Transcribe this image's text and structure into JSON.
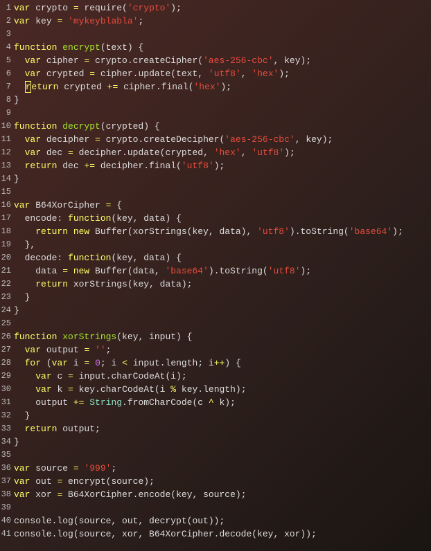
{
  "lines": [
    {
      "n": "1",
      "tokens": [
        [
          "kw",
          "var "
        ],
        [
          "ident",
          "crypto "
        ],
        [
          "op",
          "= "
        ],
        [
          "ident",
          "require"
        ],
        [
          "punct",
          "("
        ],
        [
          "str",
          "'crypto'"
        ],
        [
          "punct",
          ");"
        ]
      ]
    },
    {
      "n": "2",
      "tokens": [
        [
          "kw",
          "var "
        ],
        [
          "ident",
          "key "
        ],
        [
          "op",
          "= "
        ],
        [
          "str",
          "'mykeyblabla'"
        ],
        [
          "punct",
          ";"
        ]
      ]
    },
    {
      "n": "3",
      "tokens": []
    },
    {
      "n": "4",
      "tokens": [
        [
          "kw",
          "function "
        ],
        [
          "fn-name",
          "encrypt"
        ],
        [
          "punct",
          "(text) {"
        ]
      ]
    },
    {
      "n": "5",
      "tokens": [
        [
          "ident",
          "  "
        ],
        [
          "kw",
          "var "
        ],
        [
          "ident",
          "cipher "
        ],
        [
          "op",
          "= "
        ],
        [
          "ident",
          "crypto.createCipher("
        ],
        [
          "str",
          "'aes-256-cbc'"
        ],
        [
          "punct",
          ", key);"
        ]
      ]
    },
    {
      "n": "6",
      "tokens": [
        [
          "ident",
          "  "
        ],
        [
          "kw",
          "var "
        ],
        [
          "ident",
          "crypted "
        ],
        [
          "op",
          "= "
        ],
        [
          "ident",
          "cipher.update(text, "
        ],
        [
          "str",
          "'utf8'"
        ],
        [
          "punct",
          ", "
        ],
        [
          "str",
          "'hex'"
        ],
        [
          "punct",
          ");"
        ]
      ]
    },
    {
      "n": "7",
      "tokens": [
        [
          "ident",
          "  "
        ],
        [
          "cursor",
          "r"
        ],
        [
          "kw",
          "eturn "
        ],
        [
          "ident",
          "crypted "
        ],
        [
          "op",
          "+= "
        ],
        [
          "ident",
          "cipher.final("
        ],
        [
          "str",
          "'hex'"
        ],
        [
          "punct",
          ");"
        ]
      ]
    },
    {
      "n": "8",
      "tokens": [
        [
          "punct",
          "}"
        ]
      ]
    },
    {
      "n": "9",
      "tokens": []
    },
    {
      "n": "10",
      "tokens": [
        [
          "kw",
          "function "
        ],
        [
          "fn-name",
          "decrypt"
        ],
        [
          "punct",
          "(crypted) {"
        ]
      ]
    },
    {
      "n": "11",
      "tokens": [
        [
          "ident",
          "  "
        ],
        [
          "kw",
          "var "
        ],
        [
          "ident",
          "decipher "
        ],
        [
          "op",
          "= "
        ],
        [
          "ident",
          "crypto.createDecipher("
        ],
        [
          "str",
          "'aes-256-cbc'"
        ],
        [
          "punct",
          ", key);"
        ]
      ]
    },
    {
      "n": "12",
      "tokens": [
        [
          "ident",
          "  "
        ],
        [
          "kw",
          "var "
        ],
        [
          "ident",
          "dec "
        ],
        [
          "op",
          "= "
        ],
        [
          "ident",
          "decipher.update(crypted, "
        ],
        [
          "str",
          "'hex'"
        ],
        [
          "punct",
          ", "
        ],
        [
          "str",
          "'utf8'"
        ],
        [
          "punct",
          ");"
        ]
      ]
    },
    {
      "n": "13",
      "tokens": [
        [
          "ident",
          "  "
        ],
        [
          "kw",
          "return "
        ],
        [
          "ident",
          "dec "
        ],
        [
          "op",
          "+= "
        ],
        [
          "ident",
          "decipher.final("
        ],
        [
          "str",
          "'utf8'"
        ],
        [
          "punct",
          ");"
        ]
      ]
    },
    {
      "n": "14",
      "tokens": [
        [
          "punct",
          "}"
        ]
      ]
    },
    {
      "n": "15",
      "tokens": []
    },
    {
      "n": "16",
      "tokens": [
        [
          "kw",
          "var "
        ],
        [
          "ident",
          "B64XorCipher "
        ],
        [
          "op",
          "= "
        ],
        [
          "punct",
          "{"
        ]
      ]
    },
    {
      "n": "17",
      "tokens": [
        [
          "ident",
          "  encode: "
        ],
        [
          "kw",
          "function"
        ],
        [
          "punct",
          "(key, data) {"
        ]
      ]
    },
    {
      "n": "18",
      "tokens": [
        [
          "ident",
          "    "
        ],
        [
          "kw",
          "return new "
        ],
        [
          "ident",
          "Buffer(xorStrings(key, data), "
        ],
        [
          "str",
          "'utf8'"
        ],
        [
          "ident",
          ").toString("
        ],
        [
          "str",
          "'base64'"
        ],
        [
          "punct",
          ");"
        ]
      ]
    },
    {
      "n": "19",
      "tokens": [
        [
          "punct",
          "  },"
        ]
      ]
    },
    {
      "n": "20",
      "tokens": [
        [
          "ident",
          "  decode: "
        ],
        [
          "kw",
          "function"
        ],
        [
          "punct",
          "(key, data) {"
        ]
      ]
    },
    {
      "n": "21",
      "tokens": [
        [
          "ident",
          "    data "
        ],
        [
          "op",
          "= "
        ],
        [
          "kw",
          "new "
        ],
        [
          "ident",
          "Buffer(data, "
        ],
        [
          "str",
          "'base64'"
        ],
        [
          "ident",
          ").toString("
        ],
        [
          "str",
          "'utf8'"
        ],
        [
          "punct",
          ");"
        ]
      ]
    },
    {
      "n": "22",
      "tokens": [
        [
          "ident",
          "    "
        ],
        [
          "kw",
          "return "
        ],
        [
          "ident",
          "xorStrings(key, data);"
        ]
      ]
    },
    {
      "n": "23",
      "tokens": [
        [
          "punct",
          "  }"
        ]
      ]
    },
    {
      "n": "24",
      "tokens": [
        [
          "punct",
          "}"
        ]
      ]
    },
    {
      "n": "25",
      "tokens": []
    },
    {
      "n": "26",
      "tokens": [
        [
          "kw",
          "function "
        ],
        [
          "fn-name",
          "xorStrings"
        ],
        [
          "punct",
          "(key, input) {"
        ]
      ]
    },
    {
      "n": "27",
      "tokens": [
        [
          "ident",
          "  "
        ],
        [
          "kw",
          "var "
        ],
        [
          "ident",
          "output "
        ],
        [
          "op",
          "= "
        ],
        [
          "str",
          "''"
        ],
        [
          "punct",
          ";"
        ]
      ]
    },
    {
      "n": "28",
      "tokens": [
        [
          "ident",
          "  "
        ],
        [
          "kw",
          "for "
        ],
        [
          "punct",
          "("
        ],
        [
          "kw",
          "var "
        ],
        [
          "ident",
          "i "
        ],
        [
          "op",
          "= "
        ],
        [
          "num",
          "0"
        ],
        [
          "punct",
          "; i "
        ],
        [
          "op",
          "< "
        ],
        [
          "ident",
          "input.length; i"
        ],
        [
          "op",
          "++"
        ],
        [
          "punct",
          ") {"
        ]
      ]
    },
    {
      "n": "29",
      "tokens": [
        [
          "ident",
          "    "
        ],
        [
          "kw",
          "var "
        ],
        [
          "ident",
          "c "
        ],
        [
          "op",
          "= "
        ],
        [
          "ident",
          "input.charCodeAt(i);"
        ]
      ]
    },
    {
      "n": "30",
      "tokens": [
        [
          "ident",
          "    "
        ],
        [
          "kw",
          "var "
        ],
        [
          "ident",
          "k "
        ],
        [
          "op",
          "= "
        ],
        [
          "ident",
          "key.charCodeAt(i "
        ],
        [
          "op",
          "% "
        ],
        [
          "ident",
          "key.length);"
        ]
      ]
    },
    {
      "n": "31",
      "tokens": [
        [
          "ident",
          "    output "
        ],
        [
          "op",
          "+= "
        ],
        [
          "builtin",
          "String"
        ],
        [
          "ident",
          ".fromCharCode(c "
        ],
        [
          "op",
          "^ "
        ],
        [
          "ident",
          "k);"
        ]
      ]
    },
    {
      "n": "32",
      "tokens": [
        [
          "punct",
          "  }"
        ]
      ]
    },
    {
      "n": "33",
      "tokens": [
        [
          "ident",
          "  "
        ],
        [
          "kw",
          "return "
        ],
        [
          "ident",
          "output;"
        ]
      ]
    },
    {
      "n": "34",
      "tokens": [
        [
          "punct",
          "}"
        ]
      ]
    },
    {
      "n": "35",
      "tokens": []
    },
    {
      "n": "36",
      "tokens": [
        [
          "kw",
          "var "
        ],
        [
          "ident",
          "source "
        ],
        [
          "op",
          "= "
        ],
        [
          "str",
          "'999'"
        ],
        [
          "punct",
          ";"
        ]
      ]
    },
    {
      "n": "37",
      "tokens": [
        [
          "kw",
          "var "
        ],
        [
          "ident",
          "out "
        ],
        [
          "op",
          "= "
        ],
        [
          "ident",
          "encrypt(source);"
        ]
      ]
    },
    {
      "n": "38",
      "tokens": [
        [
          "kw",
          "var "
        ],
        [
          "ident",
          "xor "
        ],
        [
          "op",
          "= "
        ],
        [
          "ident",
          "B64XorCipher.encode(key, source);"
        ]
      ]
    },
    {
      "n": "39",
      "tokens": []
    },
    {
      "n": "40",
      "tokens": [
        [
          "ident",
          "console.log(source, out, decrypt(out));"
        ]
      ]
    },
    {
      "n": "41",
      "tokens": [
        [
          "ident",
          "console.log(source, xor, B64XorCipher.decode(key, xor));"
        ]
      ]
    }
  ]
}
